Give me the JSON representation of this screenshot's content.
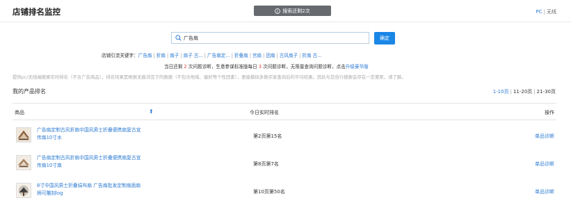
{
  "header": {
    "title": "店铺排名监控",
    "notice": "搜索还剩2次",
    "device": {
      "pc": "PC",
      "sep": "|",
      "wireless": "无线"
    }
  },
  "search": {
    "value": "广告扇",
    "confirm_label": "确定"
  },
  "keywords": {
    "label": "店铺引流关键字：",
    "items": [
      "广告扇",
      "折扇",
      "扇子",
      "扇子 古...",
      "广告扇定...",
      "折叠扇",
      "宫扇",
      "团扇",
      "古风扇子",
      "折扇 古..."
    ]
  },
  "quota": {
    "part1": "当日还剩",
    "remaining": "2",
    "part2": "次问题诊断，生意参谋标准版每日",
    "limit": "3",
    "part3": "次问题诊断，无限量查询问题诊断，点击",
    "upgrade": "升级豪华版"
  },
  "description": "提供pc/无线端搜索实时排名（不含广告商品），排名结果是根据无痕浏览下的数据（不包含地域、偏好等个性因素），更能模拟多数买家查询后的平均结果。因此与您自行搜索会存在一定差距，请了解。",
  "section_title": "我的产品排名",
  "pager": {
    "p1": "1-10页",
    "p2": "11-20页",
    "p3": "21-30页",
    "sep": "|"
  },
  "table": {
    "headers": {
      "product": "商品",
      "sort": "⬆",
      "rank": "今日实时排名",
      "action": "操作"
    },
    "rows": [
      {
        "title": "广告扇定制古风折扇中国风男士折叠便携扇复古宣传扇10寸水",
        "rank": "第2页第15名",
        "action": "单品诊断"
      },
      {
        "title": "广告扇定制古风折扇中国风男士折叠便携扇复古宣传扇10寸扇",
        "rank": "第8页第7名",
        "action": "单品诊断"
      },
      {
        "title": "8寸中国风男士折叠绢布扇 广告扇批发定制扇面扇柄可雕刻log",
        "rank": "第10页第50名",
        "action": "单品诊断"
      }
    ]
  }
}
